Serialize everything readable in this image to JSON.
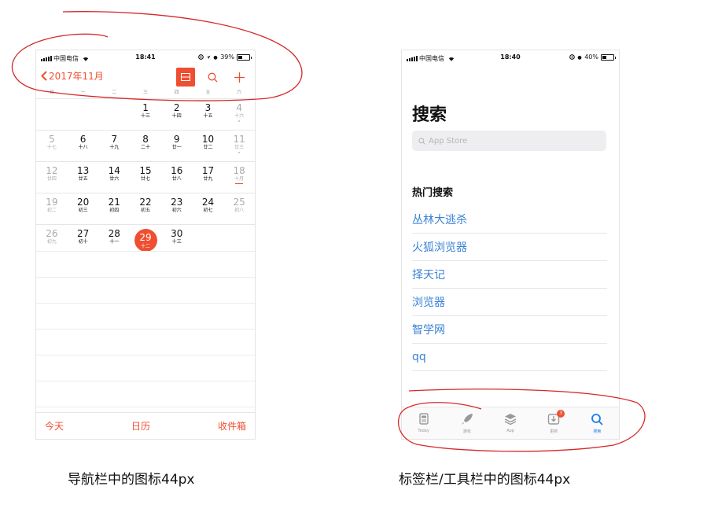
{
  "colors": {
    "accent_red": "#f04e31",
    "ios_blue": "#1a7cf0",
    "link_blue": "#3b82d6",
    "annotation_red": "#d62828"
  },
  "calendar": {
    "status": {
      "carrier": "中国电信",
      "time": "18:41",
      "battery": "39%",
      "battery_level": 0.39
    },
    "nav": {
      "back_label": "2017年11月",
      "icons": [
        "list-icon",
        "search-icon",
        "plus-icon"
      ]
    },
    "weekdays": [
      "日",
      "一",
      "二",
      "三",
      "四",
      "五",
      "六"
    ],
    "weeks": [
      [
        {
          "n": "",
          "l": ""
        },
        {
          "n": "",
          "l": ""
        },
        {
          "n": "",
          "l": ""
        },
        {
          "n": "1",
          "l": "十三"
        },
        {
          "n": "2",
          "l": "十四"
        },
        {
          "n": "3",
          "l": "十五"
        },
        {
          "n": "4",
          "l": "十六"
        }
      ],
      [
        {
          "n": "5",
          "l": "十七"
        },
        {
          "n": "6",
          "l": "十八"
        },
        {
          "n": "7",
          "l": "十九"
        },
        {
          "n": "8",
          "l": "二十"
        },
        {
          "n": "9",
          "l": "廿一"
        },
        {
          "n": "10",
          "l": "廿二"
        },
        {
          "n": "11",
          "l": "廿三"
        }
      ],
      [
        {
          "n": "12",
          "l": "廿四"
        },
        {
          "n": "13",
          "l": "廿五"
        },
        {
          "n": "14",
          "l": "廿六"
        },
        {
          "n": "15",
          "l": "廿七"
        },
        {
          "n": "16",
          "l": "廿八"
        },
        {
          "n": "17",
          "l": "廿九"
        },
        {
          "n": "18",
          "l": "十月"
        }
      ],
      [
        {
          "n": "19",
          "l": "初二"
        },
        {
          "n": "20",
          "l": "初三"
        },
        {
          "n": "21",
          "l": "初四"
        },
        {
          "n": "22",
          "l": "初五"
        },
        {
          "n": "23",
          "l": "初六"
        },
        {
          "n": "24",
          "l": "初七"
        },
        {
          "n": "25",
          "l": "初八"
        }
      ],
      [
        {
          "n": "26",
          "l": "初九"
        },
        {
          "n": "27",
          "l": "初十"
        },
        {
          "n": "28",
          "l": "十一"
        },
        {
          "n": "29",
          "l": "十二"
        },
        {
          "n": "30",
          "l": "十三"
        },
        {
          "n": "",
          "l": ""
        },
        {
          "n": "",
          "l": ""
        }
      ]
    ],
    "today": "29",
    "tabbar": {
      "today": "今天",
      "calendars": "日历",
      "inbox": "收件箱"
    }
  },
  "appstore": {
    "status": {
      "carrier": "中国电信",
      "time": "18:40",
      "battery": "40%",
      "battery_level": 0.4
    },
    "title": "搜索",
    "search_placeholder": "App Store",
    "trending_title": "热门搜索",
    "trending": [
      "丛林大逃杀",
      "火狐浏览器",
      "择天记",
      "浏览器",
      "智学网",
      "qq"
    ],
    "tabs": [
      {
        "label": "Today",
        "icon": "today-icon"
      },
      {
        "label": "游戏",
        "icon": "rocket-icon"
      },
      {
        "label": "App",
        "icon": "stack-icon"
      },
      {
        "label": "更新",
        "icon": "download-icon",
        "badge": "3"
      },
      {
        "label": "搜索",
        "icon": "search-icon",
        "active": true
      }
    ]
  },
  "captions": {
    "left": "导航栏中的图标44px",
    "right": "标签栏/工具栏中的图标44px"
  }
}
